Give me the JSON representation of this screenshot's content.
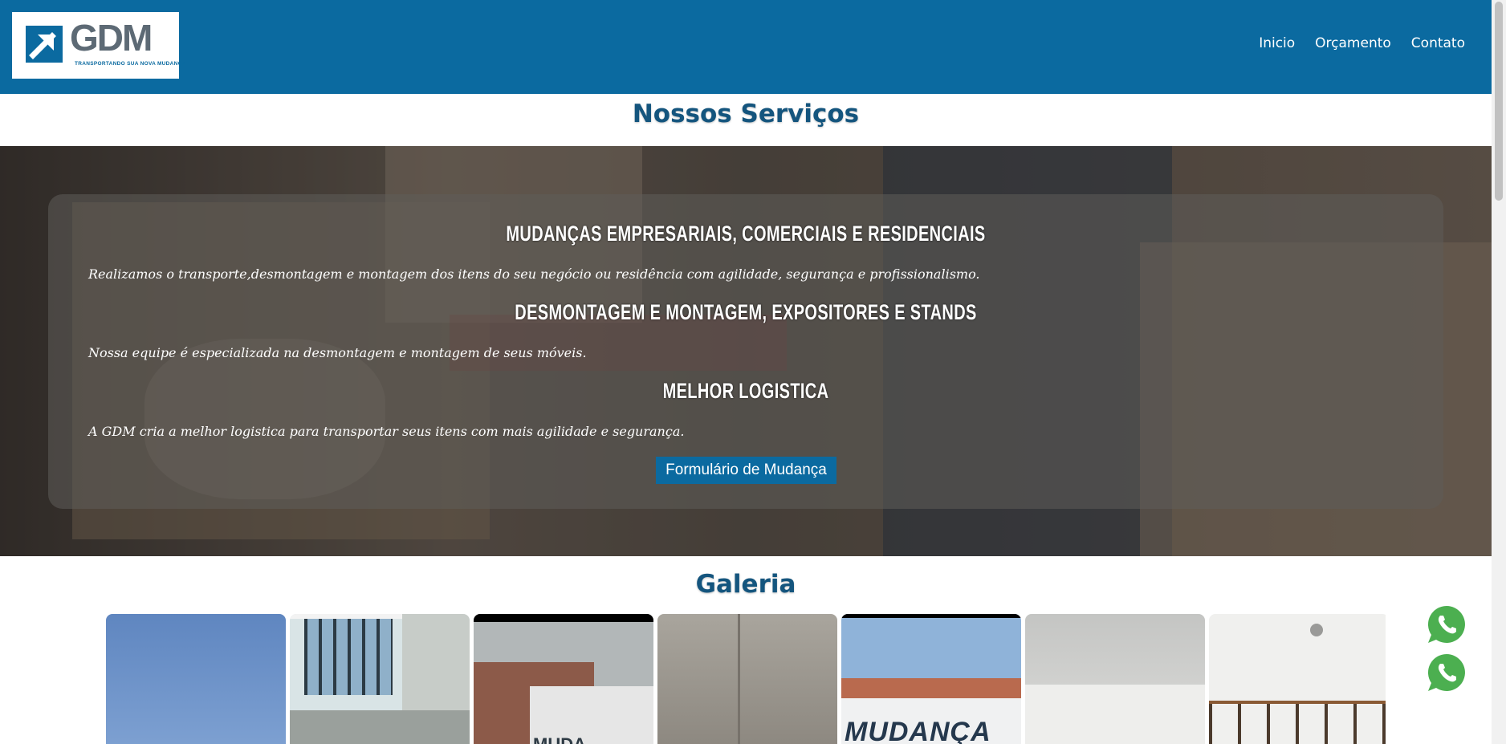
{
  "header": {
    "logo": {
      "wordmark": "GDM",
      "tagline": "TRANSPORTANDO SUA NOVA MUDANÇA"
    },
    "nav": [
      "Inicio",
      "Orçamento",
      "Contato"
    ]
  },
  "services": {
    "heading": "Nossos Serviços",
    "items": [
      {
        "title": "MUDANÇAS EMPRESARIAIS, COMERCIAIS E RESIDENCIAIS",
        "text": "Realizamos o transporte,desmontagem e montagem dos itens do seu negócio ou residência com agilidade, segurança e profissionalismo."
      },
      {
        "title": "DESMONTAGEM E MONTAGEM, EXPOSITORES E STANDS",
        "text": "Nossa equipe é especializada na desmontagem e montagem de seus móveis."
      },
      {
        "title": "MELHOR LOGISTICA",
        "text": "A GDM cria a melhor logistica para transportar seus itens com mais agilidade e segurança."
      }
    ],
    "cta_label": "Formulário de Mudança"
  },
  "gallery": {
    "heading": "Galeria",
    "photo_text": {
      "mudanca_1": "MUDA",
      "mudanca_2": "MUDANÇA"
    }
  },
  "floating": {
    "whatsapp_count": 2
  },
  "colors": {
    "brand_blue": "#0b6aa0",
    "heading_blue": "#14557e",
    "whatsapp_green": "#4caf50"
  }
}
